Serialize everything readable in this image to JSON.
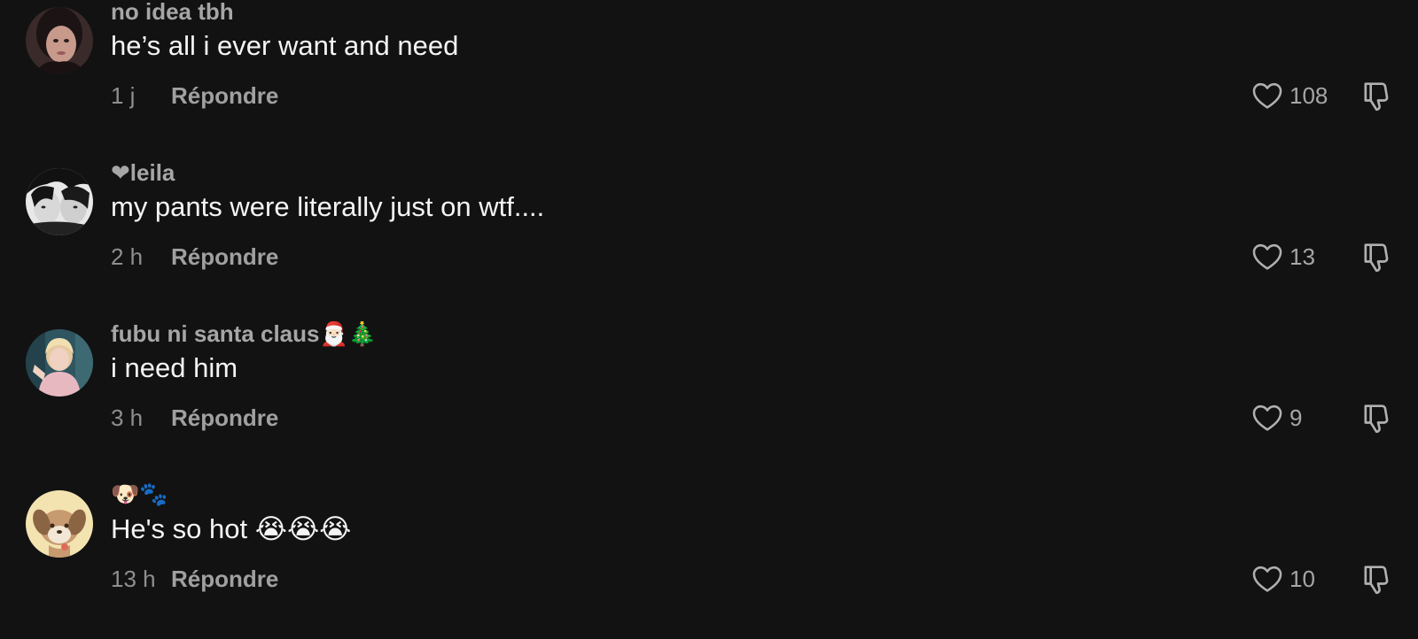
{
  "comments": [
    {
      "username": "no idea tbh",
      "text": "he’s all i ever want and need",
      "time": "1 j",
      "reply_label": "Répondre",
      "likes": "108",
      "avatar_icon": "avatar-photo-icon"
    },
    {
      "username": "❤leila",
      "text": "my pants were literally just on wtf....",
      "time": "2 h",
      "reply_label": "Répondre",
      "likes": "13",
      "avatar_icon": "avatar-photo-icon"
    },
    {
      "username": "fubu ni santa claus🎅🏻🎄",
      "text": "i need him",
      "time": "3 h",
      "reply_label": "Répondre",
      "likes": "9",
      "avatar_icon": "avatar-photo-icon"
    },
    {
      "username": "🐶🐾",
      "text": "He's so hot 😭😭😭",
      "time": "13 h",
      "reply_label": "Répondre",
      "likes": "10",
      "avatar_icon": "avatar-cartoon-dog-icon"
    }
  ],
  "colors": {
    "background": "#121212",
    "primary_text": "#f4f4f4",
    "secondary_text": "#a6a6a6",
    "icon_stroke": "#b0b0b0"
  }
}
